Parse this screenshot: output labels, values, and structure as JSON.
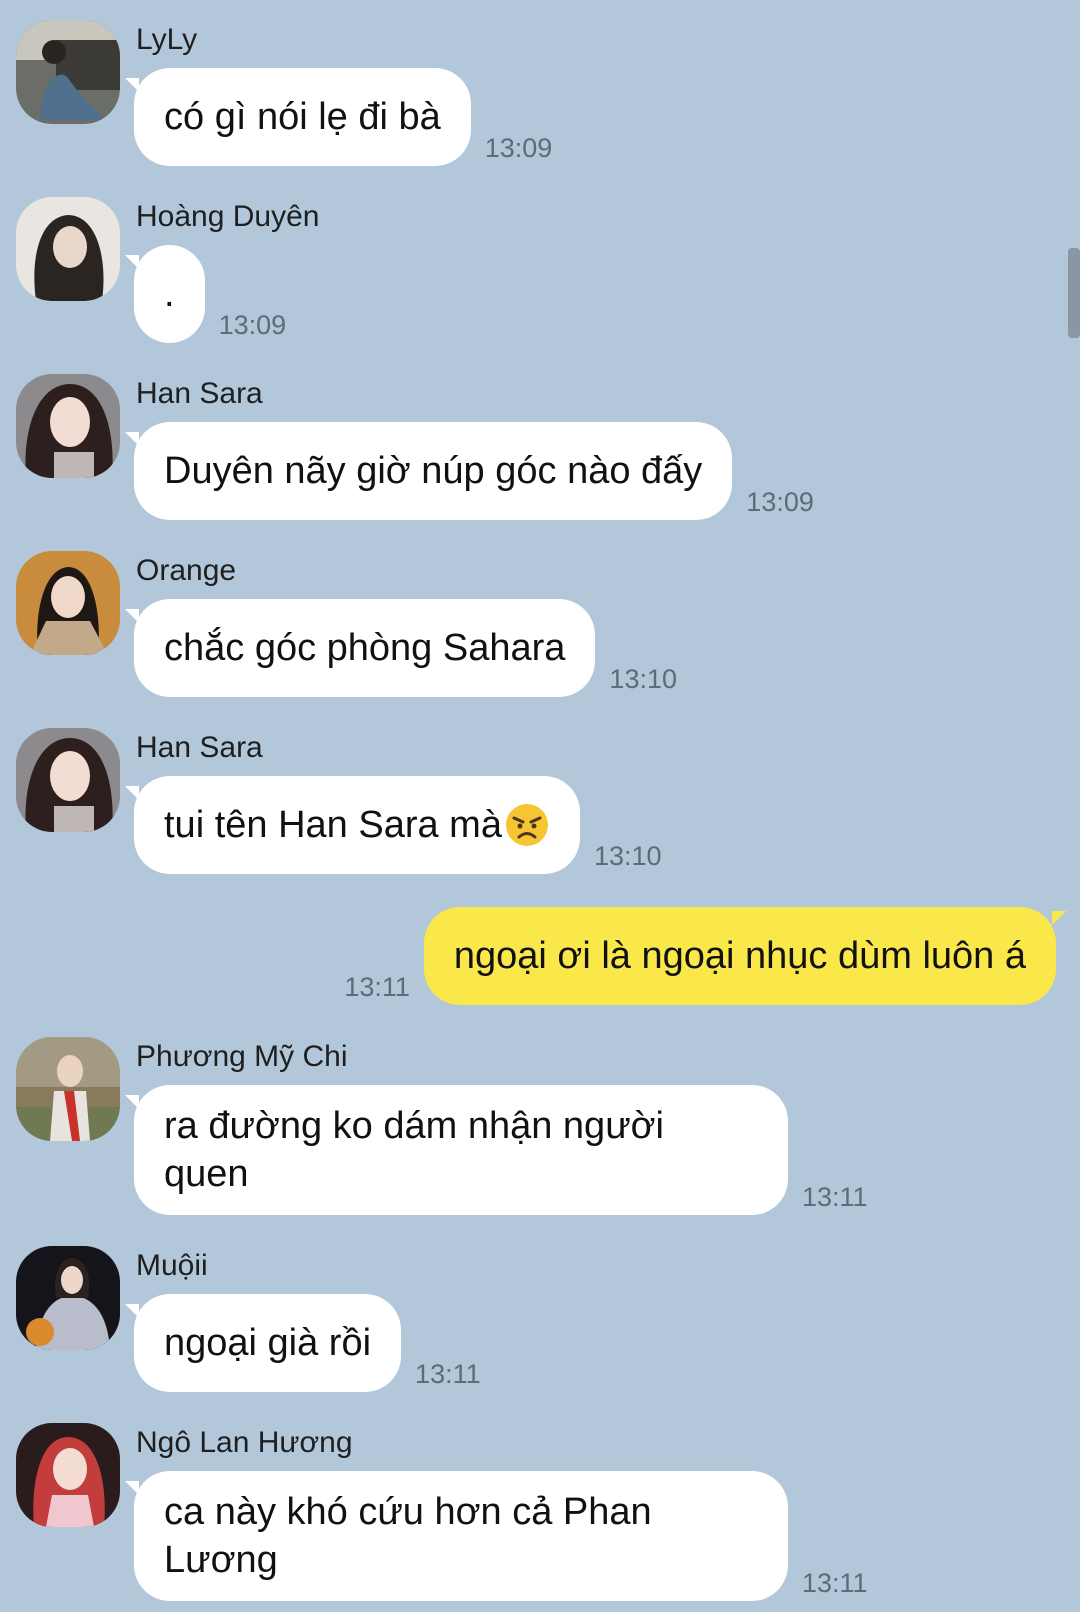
{
  "messages": [
    {
      "sender": "LyLy",
      "text": "có gì nói lẹ đi bà",
      "time": "13:09"
    },
    {
      "sender": "Hoàng Duyên",
      "text": ".",
      "time": "13:09"
    },
    {
      "sender": "Han Sara",
      "text": "Duyên nãy giờ núp góc nào đấy",
      "time": "13:09"
    },
    {
      "sender": "Orange",
      "text": "chắc góc phòng Sahara",
      "time": "13:10"
    },
    {
      "sender": "Han Sara",
      "text": "tui tên Han Sara mà",
      "emoji": "angry-face",
      "time": "13:10"
    },
    {
      "sender": "",
      "text": "ngoại ơi là ngoại nhục dùm luôn á",
      "time": "13:11",
      "mine": true
    },
    {
      "sender": "Phương Mỹ Chi",
      "text_line1": "ra đường ko dám nhận người",
      "text_line2": "quen",
      "time": "13:11"
    },
    {
      "sender": "Muộii",
      "text": "ngoại già rồi",
      "time": "13:11"
    },
    {
      "sender": "Ngô Lan Hương",
      "text_line1": "ca này khó cứu hơn cả Phan",
      "text_line2": "Lương",
      "time": "13:11"
    }
  ],
  "colors": {
    "background": "#b2c7da",
    "incoming_bubble": "#ffffff",
    "outgoing_bubble": "#fae84b"
  }
}
